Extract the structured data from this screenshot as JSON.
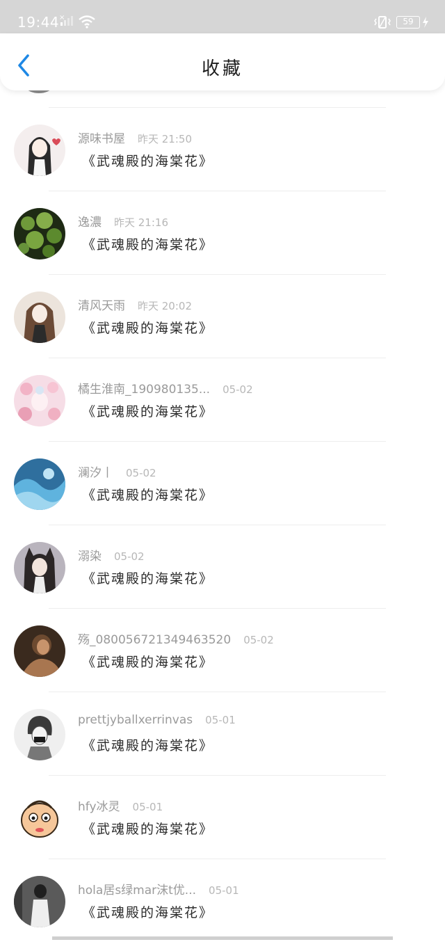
{
  "status_bar": {
    "time": "19:44",
    "battery": "59"
  },
  "header": {
    "title": "收藏"
  },
  "items": [
    {
      "username": "源味书屋",
      "time": "昨天 21:50",
      "content": "《武魂殿的海棠花》",
      "avatar": "girl-blackhair"
    },
    {
      "username": "逸濃",
      "time": "昨天 21:16",
      "content": "《武魂殿的海棠花》",
      "avatar": "green-plant"
    },
    {
      "username": "清风天雨",
      "time": "昨天 20:02",
      "content": "《武魂殿的海棠花》",
      "avatar": "girl-brown"
    },
    {
      "username": "橘生淮南_190980135...",
      "time": "05-02",
      "content": "《武魂殿的海棠花》",
      "avatar": "pink-flowers"
    },
    {
      "username": "澜汐丨",
      "time": "05-02",
      "content": "《武魂殿的海棠花》",
      "avatar": "blue-water"
    },
    {
      "username": "溺染",
      "time": "05-02",
      "content": "《武魂殿的海棠花》",
      "avatar": "catgirl"
    },
    {
      "username": "殇_080056721349463520",
      "time": "05-02",
      "content": "《武魂殿的海棠花》",
      "avatar": "dark-portrait"
    },
    {
      "username": "prettjyballxerrinvas",
      "time": "05-01",
      "content": "《武魂殿的海棠花》",
      "avatar": "sketch-boy"
    },
    {
      "username": "hfy冰灵",
      "time": "05-01",
      "content": "《武魂殿的海棠花》",
      "avatar": "cartoon-face"
    },
    {
      "username": "hola居s绿mar沫t优...",
      "time": "05-01",
      "content": "《武魂殿的海棠花》",
      "avatar": "bw-person"
    }
  ]
}
